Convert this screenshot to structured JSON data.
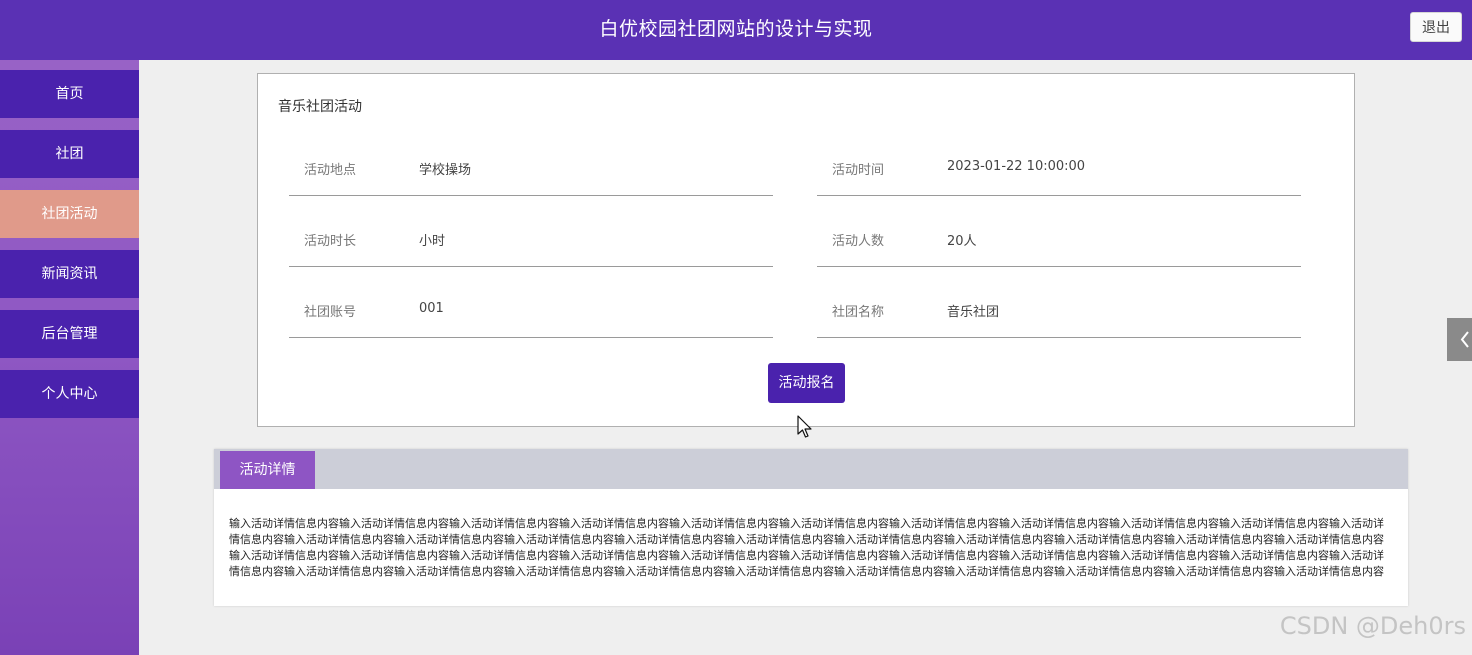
{
  "header": {
    "title": "白优校园社团网站的设计与实现",
    "logout_label": "退出"
  },
  "sidebar": {
    "items": [
      {
        "label": "首页"
      },
      {
        "label": "社团"
      },
      {
        "label": "社团活动",
        "active": true
      },
      {
        "label": "新闻资讯"
      },
      {
        "label": "后台管理"
      },
      {
        "label": "个人中心"
      }
    ]
  },
  "activity": {
    "title": "音乐社团活动",
    "fields": {
      "location": {
        "label": "活动地点",
        "value": "学校操场"
      },
      "time": {
        "label": "活动时间",
        "value": "2023-01-22 10:00:00"
      },
      "duration": {
        "label": "活动时长",
        "value": "小时"
      },
      "people": {
        "label": "活动人数",
        "value": "20人"
      },
      "club_account": {
        "label": "社团账号",
        "value": "001"
      },
      "club_name": {
        "label": "社团名称",
        "value": "音乐社团"
      }
    },
    "signup_label": "活动报名"
  },
  "details": {
    "tab_label": "活动详情",
    "text": "输入活动详情信息内容输入活动详情信息内容输入活动详情信息内容输入活动详情信息内容输入活动详情信息内容输入活动详情信息内容输入活动详情信息内容输入活动详情信息内容输入活动详情信息内容输入活动详情信息内容输入活动详情信息内容输入活动详情信息内容输入活动详情信息内容输入活动详情信息内容输入活动详情信息内容输入活动详情信息内容输入活动详情信息内容输入活动详情信息内容输入活动详情信息内容输入活动详情信息内容输入活动详情信息内容输入活动详情信息内容输入活动详情信息内容输入活动详情信息内容输入活动详情信息内容输入活动详情信息内容输入活动详情信息内容输入活动详情信息内容输入活动详情信息内容输入活动详情信息内容输入活动详情信息内容输入活动详情信息内容输入活动详情信息内容输入活动详情信息内容输入活动详情信息内容输入活动详情信息内容输入活动详情信息内容输入活动详情信息内容输入活动详情信息内容输入活动详情信息内容输入活动详情信息内容输入活动详情信息内容"
  },
  "icons": {
    "right_toggle": "chevron-left-icon",
    "cursor": "mouse-pointer-icon"
  },
  "colors": {
    "header": "#5a31b4",
    "nav": "#4a22ad",
    "nav_active": "#e09a8a",
    "tab_active": "#8e55c4"
  },
  "watermark": "CSDN @Deh0rs"
}
